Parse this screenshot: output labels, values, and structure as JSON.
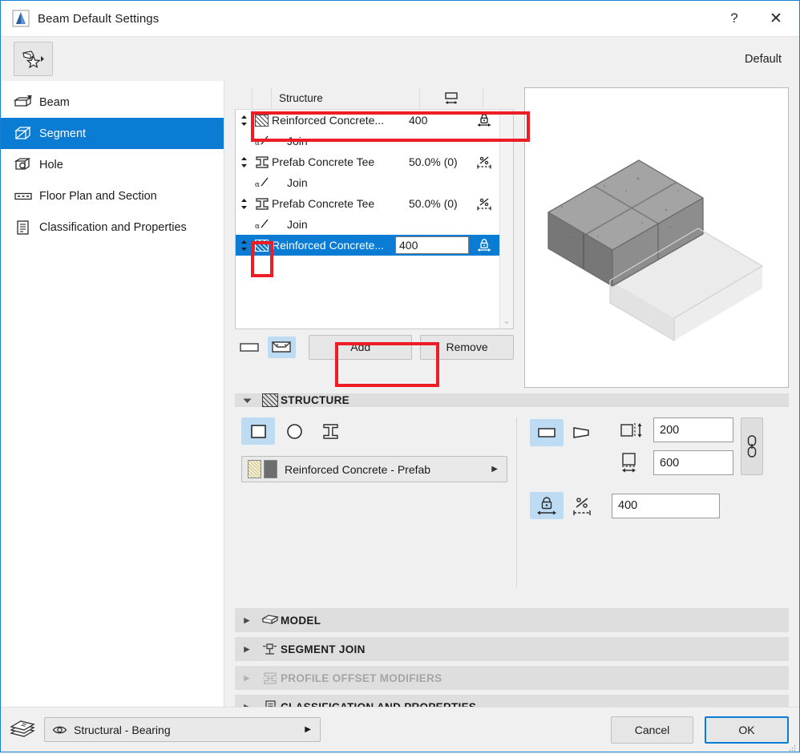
{
  "window": {
    "title": "Beam Default Settings",
    "help_label": "?",
    "close_label": "✕",
    "default_label": "Default"
  },
  "sidebar": {
    "items": [
      {
        "label": "Beam",
        "icon": "beam-icon",
        "selected": false
      },
      {
        "label": "Segment",
        "icon": "segment-icon",
        "selected": true
      },
      {
        "label": "Hole",
        "icon": "hole-icon",
        "selected": false
      },
      {
        "label": "Floor Plan and Section",
        "icon": "floor-plan-icon",
        "selected": false
      },
      {
        "label": "Classification and Properties",
        "icon": "classification-icon",
        "selected": false
      }
    ]
  },
  "segment_list": {
    "header": {
      "name": "Structure",
      "dimension_icon": "width-dimension-icon"
    },
    "rows": [
      {
        "type": "structure",
        "icon": "hatch-icon",
        "name": "Reinforced Concrete...",
        "value": "400",
        "right_icon": "fixed-dimension-lock-icon",
        "selected": false,
        "highlighted": true
      },
      {
        "type": "join",
        "icon": "angle-join-icon",
        "name": "Join",
        "value": "",
        "right_icon": "",
        "selected": false
      },
      {
        "type": "structure",
        "icon": "profile-tee-icon",
        "name": "Prefab Concrete Tee",
        "value": "50.0% (0)",
        "right_icon": "percentage-dimension-icon",
        "selected": false
      },
      {
        "type": "join",
        "icon": "angle-join-icon",
        "name": "Join",
        "value": "",
        "right_icon": "",
        "selected": false
      },
      {
        "type": "structure",
        "icon": "profile-tee-icon",
        "name": "Prefab Concrete Tee",
        "value": "50.0% (0)",
        "right_icon": "percentage-dimension-icon",
        "selected": false
      },
      {
        "type": "join",
        "icon": "angle-join-icon",
        "name": "Join",
        "value": "",
        "right_icon": "",
        "selected": false
      },
      {
        "type": "structure",
        "icon": "hatch-icon",
        "name": "Reinforced Concrete...",
        "value": "400",
        "right_icon": "fixed-dimension-lock-icon",
        "selected": true
      }
    ],
    "toggles": [
      {
        "icon": "simple-beam-icon",
        "on": false
      },
      {
        "icon": "segmented-beam-icon",
        "on": true
      }
    ],
    "add_label": "Add",
    "remove_label": "Remove",
    "scroll_up": "⌃",
    "scroll_down": "⌄"
  },
  "preview": {
    "name": "3d-preview",
    "description": "Isometric concrete beam segments"
  },
  "structure_section": {
    "title": "STRUCTURE",
    "expanded": true,
    "shape_toggles": [
      {
        "icon": "rectangle-profile-icon",
        "on": true
      },
      {
        "icon": "circle-profile-icon",
        "on": false
      },
      {
        "icon": "ibeam-profile-icon",
        "on": false
      }
    ],
    "material": "Reinforced Concrete - Prefab",
    "material_arrow": "▶",
    "end_toggles": [
      {
        "icon": "straight-segment-icon",
        "on": true
      },
      {
        "icon": "tapered-segment-icon",
        "on": false
      }
    ],
    "height": {
      "icon": "height-dimension-icon",
      "value": "200"
    },
    "width": {
      "icon": "width-dimension-icon",
      "value": "600"
    },
    "link_icon": "link-chain-icon",
    "length_toggles": [
      {
        "icon": "fixed-length-lock-icon",
        "on": true
      },
      {
        "icon": "percentage-length-icon",
        "on": false
      }
    ],
    "length": {
      "value": "400"
    }
  },
  "collapsed_sections": [
    {
      "title": "MODEL",
      "icon": "model-box-icon",
      "disabled": false,
      "arrow": "▶"
    },
    {
      "title": "SEGMENT JOIN",
      "icon": "segment-join-icon",
      "disabled": false,
      "arrow": "▶"
    },
    {
      "title": "PROFILE OFFSET MODIFIERS",
      "icon": "profile-offset-icon",
      "disabled": true,
      "arrow": "▶"
    },
    {
      "title": "CLASSIFICATION AND PROPERTIES",
      "icon": "classification-icon",
      "disabled": false,
      "arrow": "▶"
    }
  ],
  "footer": {
    "layer_icon": "layers-icon",
    "layer_eye_icon": "eye-icon",
    "layer_value": "Structural - Bearing",
    "layer_arrow": "▶",
    "cancel_label": "Cancel",
    "ok_label": "OK"
  },
  "colors": {
    "accent": "#0a7cd4",
    "annotation_red": "#ee1c25",
    "toggle_on": "#bddcf4",
    "window_bg": "#f0f0f0",
    "section_header": "#dedede"
  }
}
